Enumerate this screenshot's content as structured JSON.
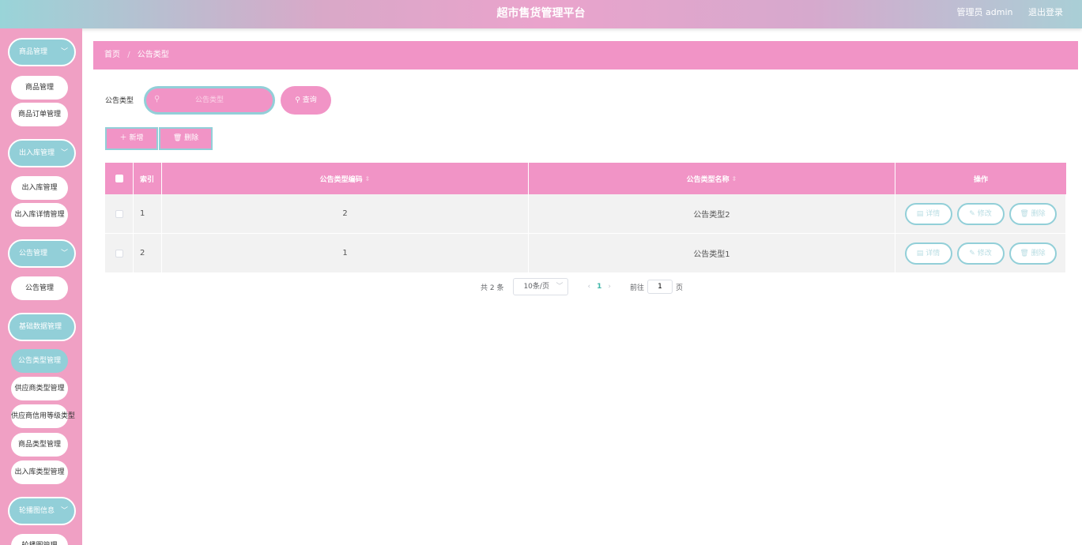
{
  "header": {
    "title": "超市售货管理平台",
    "user_label": "管理员 admin",
    "logout_label": "退出登录"
  },
  "sidebar": {
    "groups": [
      {
        "label": "商品管理",
        "items": [
          "商品管理",
          "商品订单管理"
        ]
      },
      {
        "label": "出入库管理",
        "items": [
          "出入库管理",
          "出入库详情管理"
        ]
      },
      {
        "label": "公告管理",
        "items": [
          "公告管理"
        ]
      },
      {
        "label": "基础数据管理",
        "items": [
          "公告类型管理",
          "供应商类型管理",
          "供应商信用等级类型",
          "商品类型管理",
          "出入库类型管理"
        ]
      },
      {
        "label": "轮播图信息",
        "items": [
          "轮播图管理"
        ]
      }
    ],
    "active_item": "公告类型管理"
  },
  "breadcrumb": {
    "home": "首页",
    "sep": "/",
    "current": "公告类型"
  },
  "search": {
    "label": "公告类型",
    "placeholder": "公告类型",
    "query_label": "查询"
  },
  "actions": {
    "add_label": "新增",
    "delete_label": "删除"
  },
  "table": {
    "headers": [
      "索引",
      "公告类型编码",
      "公告类型名称",
      "操作"
    ],
    "rows": [
      {
        "index": "1",
        "code": "2",
        "name": "公告类型2"
      },
      {
        "index": "2",
        "code": "1",
        "name": "公告类型1"
      }
    ],
    "row_actions": {
      "detail": "详情",
      "edit": "修改",
      "delete": "删除"
    }
  },
  "pagination": {
    "total_text": "共 2 条",
    "page_size": "10条/页",
    "current_page": "1",
    "goto_label": "前往",
    "goto_value": "1",
    "page_suffix": "页"
  },
  "colors": {
    "pink": "#f194c6",
    "teal": "#92cfd8"
  }
}
